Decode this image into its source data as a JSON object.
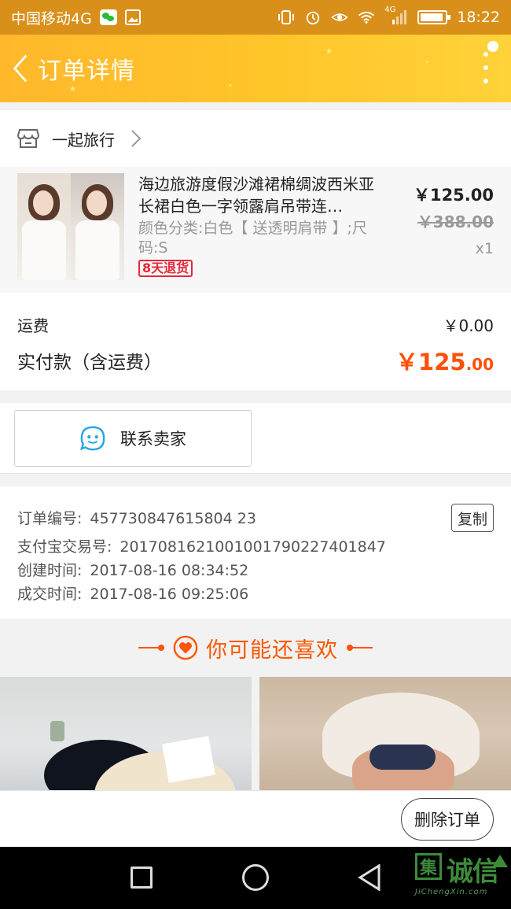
{
  "status_bar": {
    "carrier": "中国移动4G",
    "network_small": "4G",
    "time": "18:22"
  },
  "header": {
    "title": "订单详情"
  },
  "shop": {
    "name": "一起旅行"
  },
  "product": {
    "name": "海边旅游度假沙滩裙棉绸波西米亚长裙白色一字领露肩吊带连…",
    "sku": "颜色分类:白色【 送透明肩带 】;尺码:S",
    "return_tag": "8天退货",
    "price": "￥125.00",
    "original_price": "￥388.00",
    "quantity": "x1"
  },
  "fees": {
    "shipping_label": "运费",
    "shipping_value": "￥0.00",
    "total_label": "实付款（含运费）",
    "total_int": "￥125",
    "total_dec": ".00"
  },
  "contact": {
    "label": "联系卖家"
  },
  "order_info": {
    "order_no_label": "订单编号:",
    "order_no": "457730847615804 23",
    "alipay_label": "支付宝交易号:",
    "alipay_no": "2017081621001001790227401847",
    "created_label": "创建时间:",
    "created": "2017-08-16 08:34:52",
    "closed_label": "成交时间:",
    "closed": "2017-08-16 09:25:06",
    "copy_label": "复制"
  },
  "recommend": {
    "title": "你可能还喜欢"
  },
  "actions": {
    "delete_label": "删除订单"
  },
  "watermark": {
    "box": "集",
    "text": "诚信",
    "url": "JiChengXin.com"
  },
  "colors": {
    "accent": "#ff5000",
    "header": "#ffc62a",
    "status_bar": "#d9901a"
  }
}
